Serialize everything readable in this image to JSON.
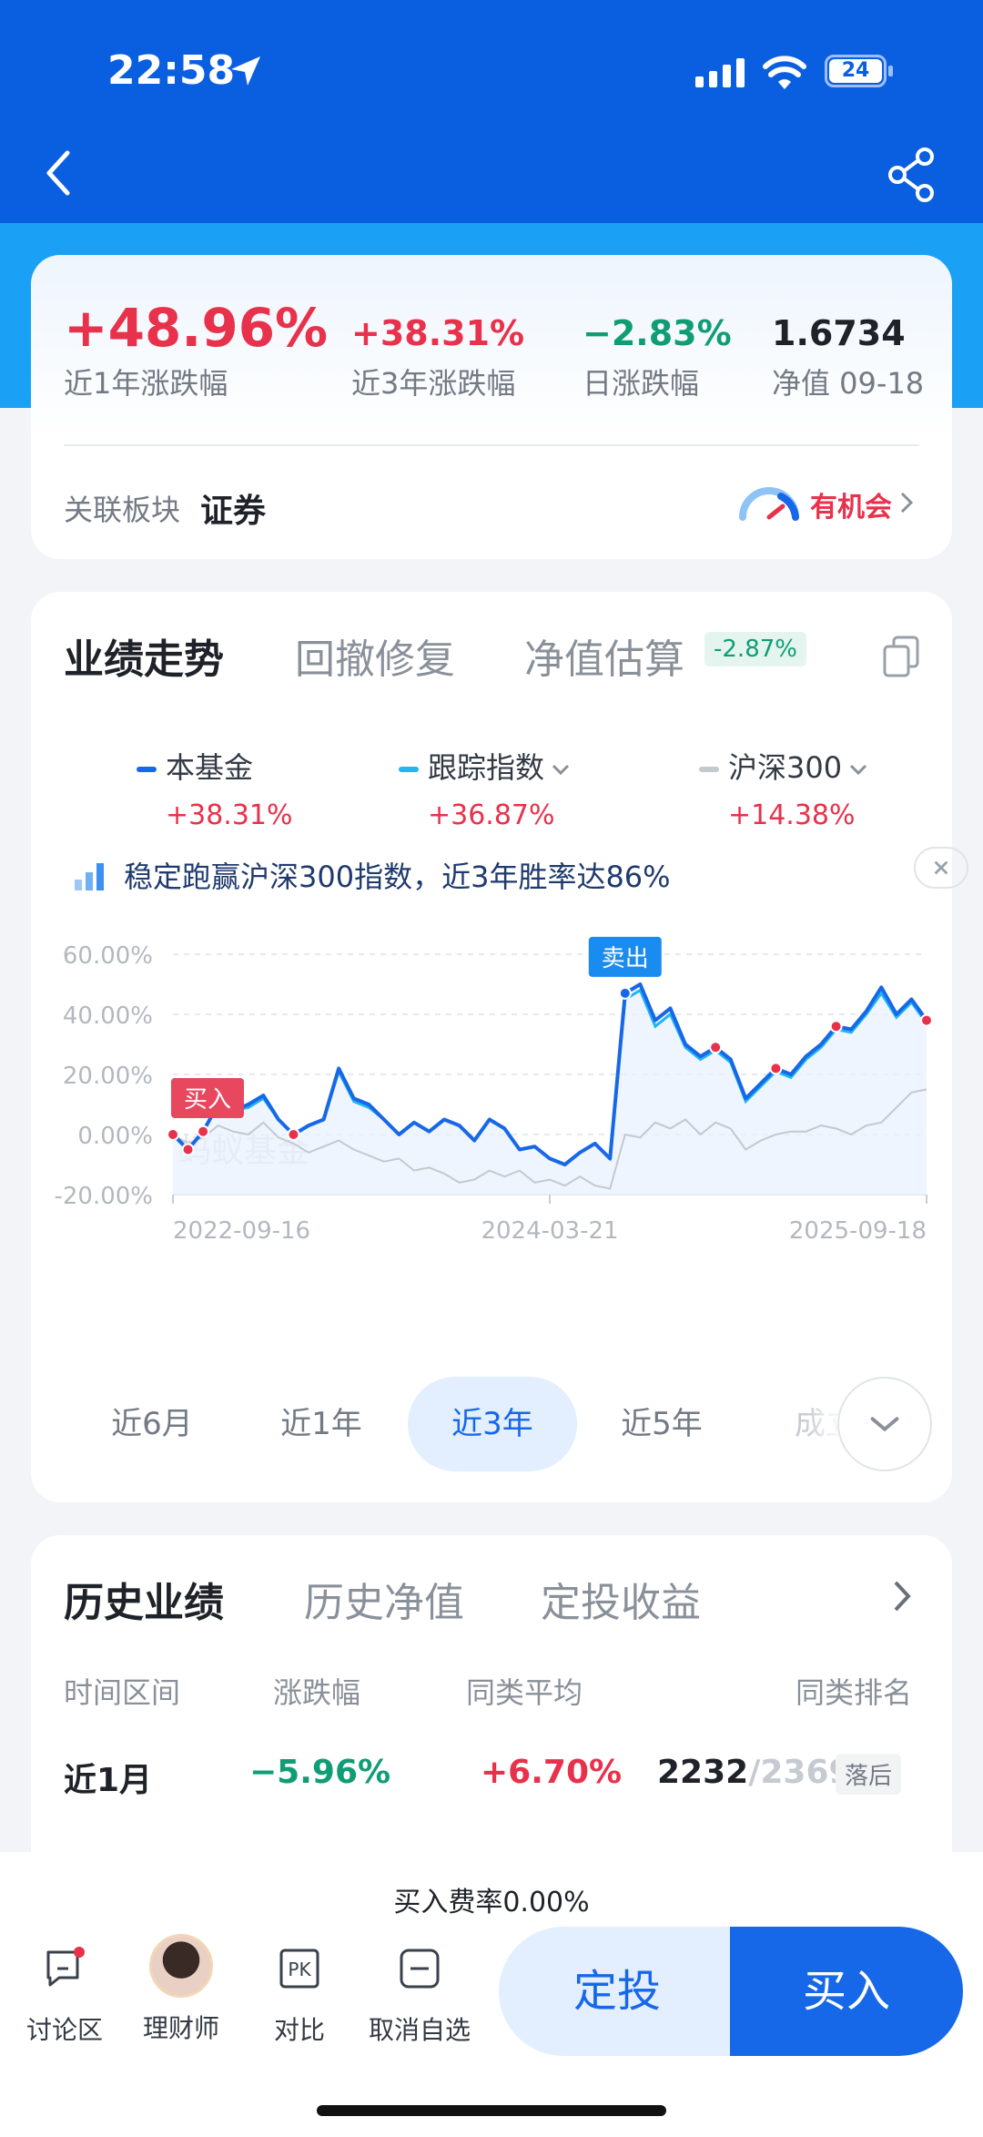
{
  "status": {
    "time": "22:58",
    "battery": "24"
  },
  "summary": {
    "stats": [
      {
        "value": "+48.96%",
        "label": "近1年涨跌幅",
        "color": "red"
      },
      {
        "value": "+38.31%",
        "label": "近3年涨跌幅",
        "color": "red"
      },
      {
        "value": "−2.83%",
        "label": "日涨跌幅",
        "color": "green"
      },
      {
        "value": "1.6734",
        "label": "净值 09-18",
        "color": "dark"
      }
    ],
    "sector_label": "关联板块",
    "sector_name": "证券",
    "opportunity": "有机会"
  },
  "perf": {
    "tabs": [
      "业绩走势",
      "回撤修复",
      "净值估算"
    ],
    "estimate_badge": "-2.87%",
    "legend": [
      {
        "name": "本基金",
        "value": "+38.31%",
        "color": "#1768e8"
      },
      {
        "name": "跟踪指数",
        "value": "+36.87%",
        "color": "#1fb6f2"
      },
      {
        "name": "沪深300",
        "value": "+14.38%",
        "color": "#c4c8cf"
      }
    ],
    "tip": "稳定跑赢沪深300指数，近3年胜率达86%",
    "range_tabs": [
      "近6月",
      "近1年",
      "近3年",
      "近5年",
      "成立"
    ]
  },
  "chart_data": {
    "type": "line",
    "ylim": [
      -20,
      60
    ],
    "y_ticks": [
      "60.00%",
      "40.00%",
      "20.00%",
      "0.00%",
      "-20.00%"
    ],
    "x_ticks": [
      "2022-09-16",
      "2024-03-21",
      "2025-09-18"
    ],
    "watermark": "蚂蚁基金",
    "buy_label": "买入",
    "sell_label": "卖出",
    "x": [
      0,
      0.02,
      0.04,
      0.06,
      0.08,
      0.1,
      0.12,
      0.14,
      0.16,
      0.18,
      0.2,
      0.22,
      0.24,
      0.26,
      0.28,
      0.3,
      0.32,
      0.34,
      0.36,
      0.38,
      0.4,
      0.42,
      0.44,
      0.46,
      0.48,
      0.5,
      0.52,
      0.54,
      0.56,
      0.58,
      0.6,
      0.62,
      0.64,
      0.66,
      0.68,
      0.7,
      0.72,
      0.74,
      0.76,
      0.78,
      0.8,
      0.82,
      0.84,
      0.86,
      0.88,
      0.9,
      0.92,
      0.94,
      0.96,
      0.98,
      1.0
    ],
    "series": [
      {
        "name": "本基金",
        "values": [
          0,
          -5,
          1,
          10,
          8,
          10,
          13,
          5,
          0,
          3,
          5,
          22,
          12,
          10,
          5,
          0,
          4,
          1,
          5,
          3,
          -2,
          5,
          2,
          -5,
          -4,
          -8,
          -10,
          -6,
          -3,
          -8,
          47,
          50,
          38,
          42,
          30,
          26,
          29,
          25,
          12,
          17,
          22,
          20,
          26,
          30,
          36,
          35,
          41,
          49,
          40,
          45,
          38
        ]
      },
      {
        "name": "跟踪指数",
        "values": [
          0,
          -5,
          1,
          10,
          8,
          9,
          12,
          5,
          0,
          3,
          5,
          21,
          11,
          9,
          5,
          0,
          4,
          1,
          5,
          3,
          -2,
          5,
          2,
          -5,
          -4,
          -8,
          -10,
          -6,
          -3,
          -8,
          45,
          48,
          36,
          40,
          29,
          25,
          28,
          24,
          11,
          16,
          21,
          19,
          25,
          29,
          35,
          34,
          40,
          47,
          39,
          44,
          37
        ]
      },
      {
        "name": "沪深300",
        "values": [
          0,
          -3,
          -1,
          3,
          1,
          0,
          4,
          -1,
          -3,
          -6,
          -4,
          -2,
          -5,
          -7,
          -9,
          -8,
          -12,
          -11,
          -13,
          -16,
          -15,
          -12,
          -14,
          -12,
          -16,
          -15,
          -17,
          -14,
          -17,
          -18,
          0,
          -1,
          4,
          2,
          5,
          0,
          4,
          2,
          -5,
          -2,
          0,
          1,
          1,
          3,
          2,
          0,
          3,
          4,
          9,
          14,
          15
        ]
      }
    ]
  },
  "history": {
    "tabs": [
      "历史业绩",
      "历史净值",
      "定投收益"
    ],
    "headers": [
      "时间区间",
      "涨跌幅",
      "同类平均",
      "同类排名"
    ],
    "row": {
      "period": "近1月",
      "change": "−5.96%",
      "avg": "+6.70%",
      "rank": "2232",
      "total": "/2369",
      "tag": "落后"
    }
  },
  "bottom": {
    "fee": "买入费率0.00%",
    "nav": [
      "讨论区",
      "理财师",
      "对比",
      "取消自选"
    ],
    "plan_label": "定投",
    "buy_label": "买入"
  }
}
